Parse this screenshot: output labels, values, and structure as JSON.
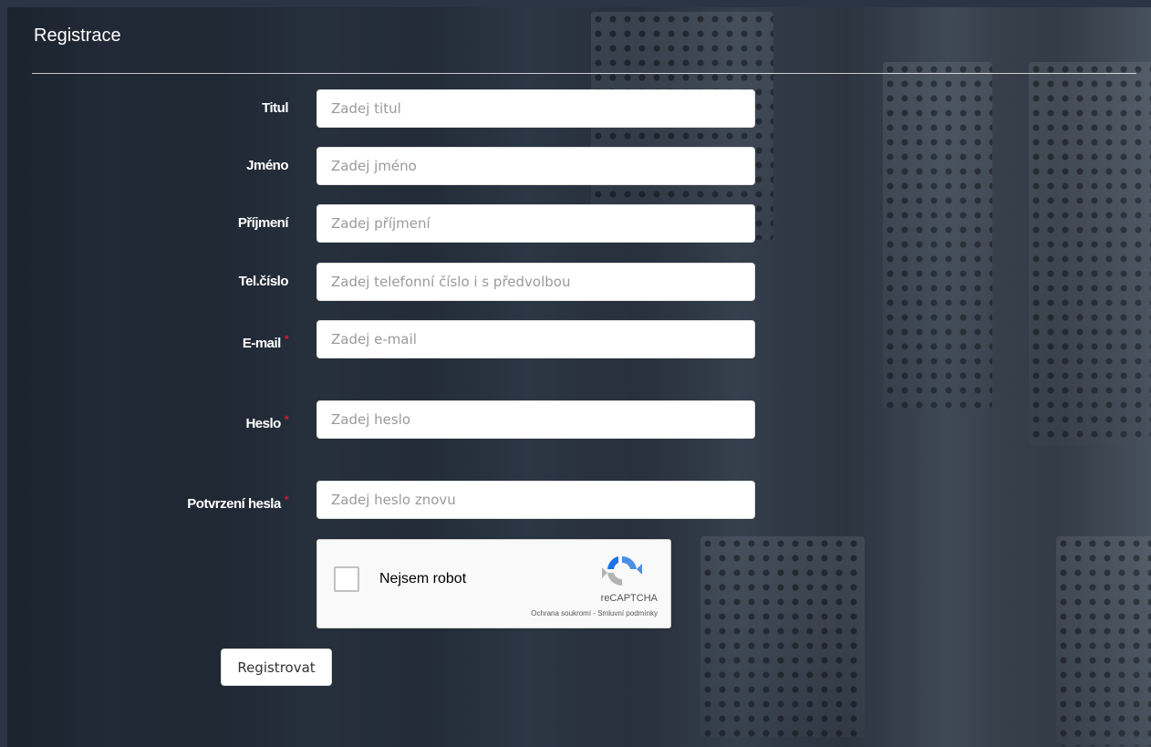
{
  "header": {
    "title": "Registrace"
  },
  "form": {
    "fields": [
      {
        "label": "Titul",
        "placeholder": "Zadej titul",
        "required": false
      },
      {
        "label": "Jméno",
        "placeholder": "Zadej jméno",
        "required": false
      },
      {
        "label": "Příjmení",
        "placeholder": "Zadej příjmení",
        "required": false
      },
      {
        "label": "Tel.číslo",
        "placeholder": "Zadej telefonní číslo i s předvolbou",
        "required": false
      },
      {
        "label": "E-mail",
        "placeholder": "Zadej e-mail",
        "required": true
      },
      {
        "label": "Heslo",
        "placeholder": "Zadej heslo",
        "required": true
      },
      {
        "label": "Potvrzení hesla",
        "placeholder": "Zadej heslo znovu",
        "required": true
      }
    ],
    "required_marker": "*",
    "submit_label": "Registrovat"
  },
  "captcha": {
    "checkbox_label": "Nejsem robot",
    "brand": "reCAPTCHA",
    "privacy": "Ochrana soukromí",
    "separator": " - ",
    "terms": "Smluvní podmínky",
    "icon": "recaptcha-logo-icon"
  },
  "colors": {
    "required": "#e0182d",
    "background": "#2b3442"
  }
}
